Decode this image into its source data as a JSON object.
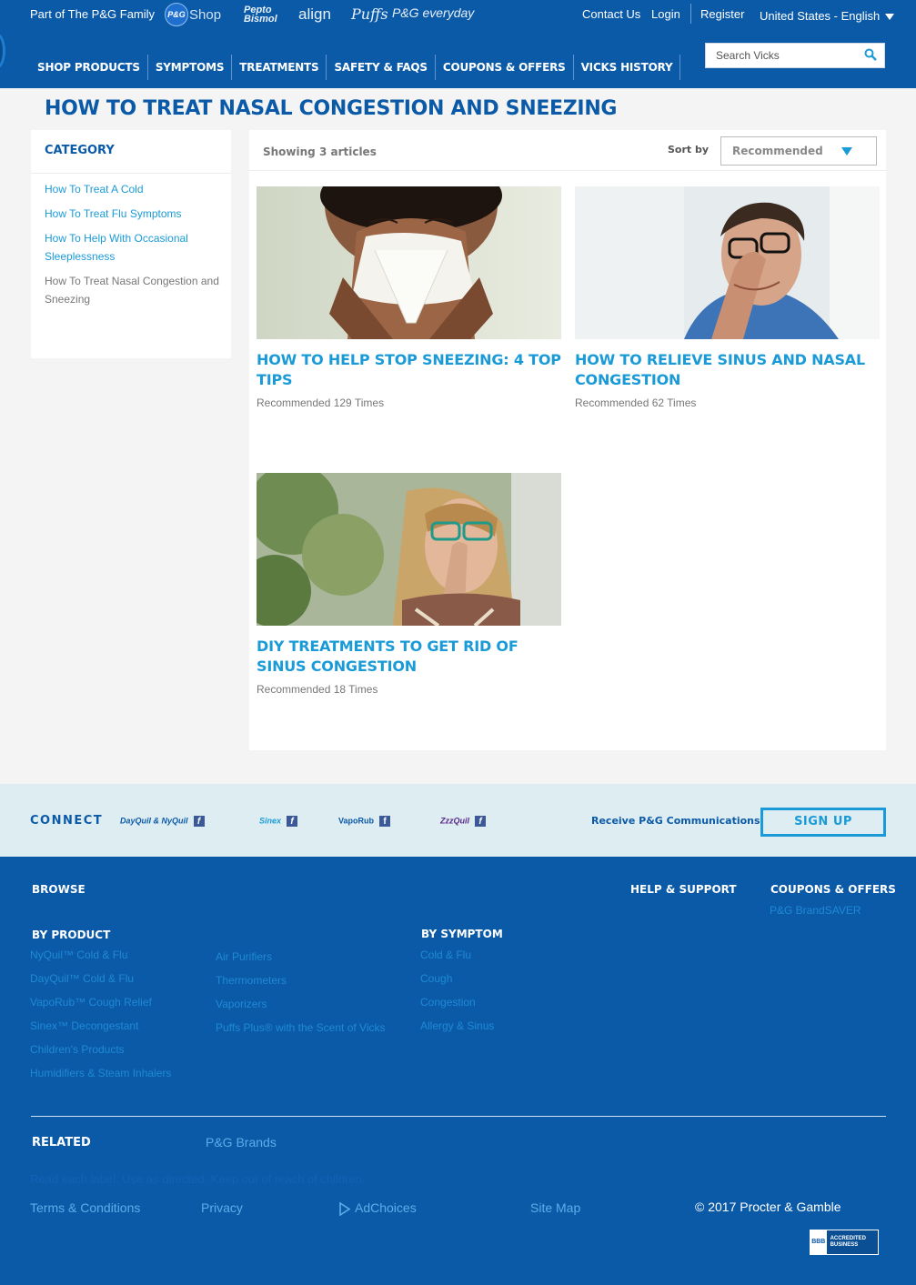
{
  "header": {
    "family_text": "Part of The P&G Family",
    "brands": {
      "pg": "P&G",
      "shop": "Shop",
      "pepto": "Pepto Bismol",
      "align": "align",
      "puffs": "Puffs",
      "everyday": "P&G everyday"
    },
    "contact": "Contact Us",
    "login": "Login",
    "register": "Register",
    "locale": "United States - English",
    "nav": [
      "SHOP PRODUCTS",
      "SYMPTOMS",
      "TREATMENTS",
      "SAFETY & FAQS",
      "COUPONS & OFFERS",
      "VICKS HISTORY"
    ],
    "search_placeholder": "Search Vicks"
  },
  "page_title": "HOW TO TREAT NASAL CONGESTION AND SNEEZING",
  "sidebar": {
    "heading": "CATEGORY",
    "items": [
      "How To Treat A Cold",
      "How To Treat Flu Symptoms",
      "How To Help With Occasional Sleeplessness",
      "How To Treat Nasal Congestion and Sneezing"
    ]
  },
  "articles": {
    "showing": "Showing 3 articles",
    "sort_label": "Sort by",
    "sort_value": "Recommended",
    "cards": [
      {
        "title": "HOW TO HELP STOP SNEEZING: 4 TOP TIPS",
        "recommended": "Recommended 129 Times"
      },
      {
        "title": "HOW TO RELIEVE SINUS AND NASAL CONGESTION",
        "recommended": "Recommended 62 Times"
      },
      {
        "title": "DIY TREATMENTS TO GET RID OF SINUS CONGESTION",
        "recommended": "Recommended 18 Times"
      }
    ]
  },
  "connect": {
    "label": "CONNECT",
    "brands": [
      "DayQuil & NyQuil",
      "Sinex",
      "VapoRub",
      "ZzzQuil"
    ],
    "fb": "f",
    "receive": "Receive P&G Communications",
    "signup": "SIGN UP"
  },
  "footer": {
    "browse": "BROWSE",
    "help": "HELP & SUPPORT",
    "coupons": "COUPONS & OFFERS",
    "brandsaver": "P&G BrandSAVER",
    "by_product": "BY PRODUCT",
    "products_col1": [
      "NyQuil™ Cold & Flu",
      "DayQuil™ Cold & Flu",
      "VapoRub™ Cough Relief",
      "Sinex™ Decongestant",
      "Children's Products",
      "Humidifiers & Steam Inhalers"
    ],
    "products_col2": [
      "Air Purifiers",
      "Thermometers",
      "Vaporizers",
      "Puffs Plus® with the Scent of Vicks"
    ],
    "by_symptom": "BY SYMPTOM",
    "symptoms": [
      "Cold & Flu",
      "Cough",
      "Congestion",
      "Allergy & Sinus"
    ],
    "related": "RELATED",
    "pg_brands": "P&G Brands",
    "disclaimer": "Read each label. Use as directed. Keep out of reach of children.",
    "terms": "Terms & Conditions",
    "privacy": "Privacy",
    "adchoices": "AdChoices",
    "sitemap": "Site Map",
    "copyright": "© 2017 Procter & Gamble",
    "bbb_seal": "BBB",
    "bbb_text": "ACCREDITED BUSINESS"
  },
  "colors": {
    "brand_blue": "#0b5aa8",
    "accent_cyan": "#1a9bd7",
    "connect_bg": "#deedf2"
  }
}
